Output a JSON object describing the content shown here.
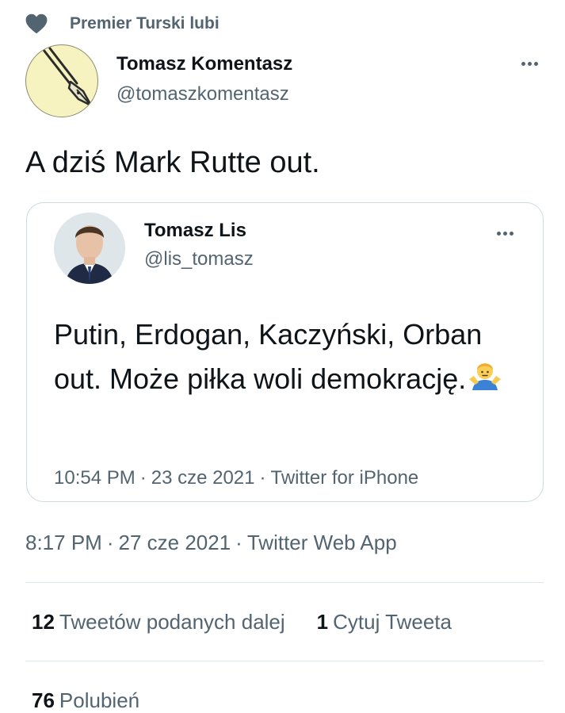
{
  "social_context": {
    "icon": "heart-icon",
    "text": "Premier Turski lubi"
  },
  "tweet": {
    "author": {
      "display_name": "Tomasz Komentasz",
      "handle": "@tomaszkomentasz",
      "avatar_icon": "fountain-pen-icon"
    },
    "text": "A dziś Mark Rutte out.",
    "timestamp": "8:17 PM",
    "date": "27 cze 2021",
    "source": "Twitter Web App"
  },
  "quoted_tweet": {
    "author": {
      "display_name": "Tomasz Lis",
      "handle": "@lis_tomasz"
    },
    "text": "Putin, Erdogan, Kaczyński, Orban out. Może piłka woli demokrację.",
    "emoji": "person-shrugging-emoji",
    "timestamp": "10:54 PM",
    "date": "23 cze 2021",
    "source": "Twitter for iPhone"
  },
  "stats": {
    "retweets_count": "12",
    "retweets_label": "Tweetów podanych dalej",
    "quotes_count": "1",
    "quotes_label": "Cytuj Tweeta",
    "likes_count": "76",
    "likes_label": "Polubień"
  },
  "separator": "·",
  "colors": {
    "primary_text": "#0f1419",
    "secondary_text": "#536471",
    "border": "#cfd9de",
    "divider": "#e1e8ed",
    "avatar_bg": "#f6f3c0"
  }
}
